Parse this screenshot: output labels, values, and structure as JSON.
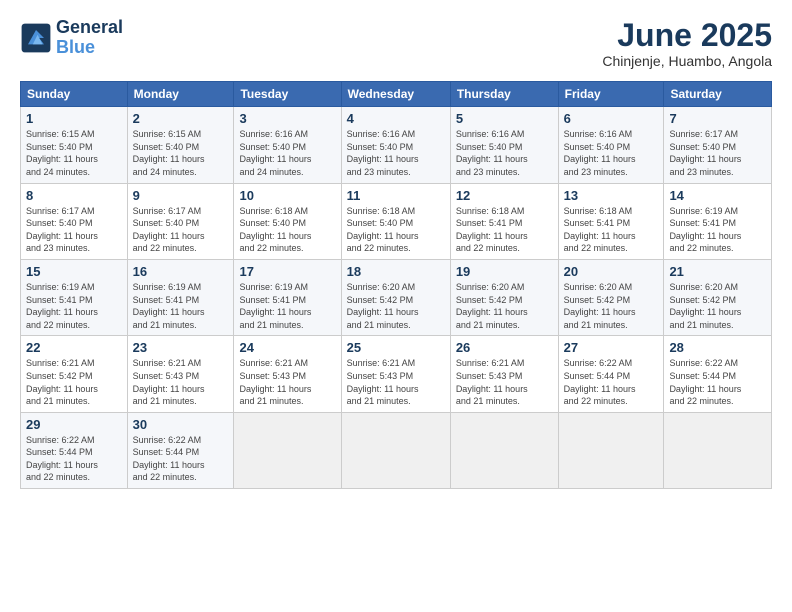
{
  "logo": {
    "line1": "General",
    "line2": "Blue"
  },
  "title": "June 2025",
  "subtitle": "Chinjenje, Huambo, Angola",
  "days_of_week": [
    "Sunday",
    "Monday",
    "Tuesday",
    "Wednesday",
    "Thursday",
    "Friday",
    "Saturday"
  ],
  "weeks": [
    [
      {
        "day": "1",
        "info": "Sunrise: 6:15 AM\nSunset: 5:40 PM\nDaylight: 11 hours\nand 24 minutes."
      },
      {
        "day": "2",
        "info": "Sunrise: 6:15 AM\nSunset: 5:40 PM\nDaylight: 11 hours\nand 24 minutes."
      },
      {
        "day": "3",
        "info": "Sunrise: 6:16 AM\nSunset: 5:40 PM\nDaylight: 11 hours\nand 24 minutes."
      },
      {
        "day": "4",
        "info": "Sunrise: 6:16 AM\nSunset: 5:40 PM\nDaylight: 11 hours\nand 23 minutes."
      },
      {
        "day": "5",
        "info": "Sunrise: 6:16 AM\nSunset: 5:40 PM\nDaylight: 11 hours\nand 23 minutes."
      },
      {
        "day": "6",
        "info": "Sunrise: 6:16 AM\nSunset: 5:40 PM\nDaylight: 11 hours\nand 23 minutes."
      },
      {
        "day": "7",
        "info": "Sunrise: 6:17 AM\nSunset: 5:40 PM\nDaylight: 11 hours\nand 23 minutes."
      }
    ],
    [
      {
        "day": "8",
        "info": "Sunrise: 6:17 AM\nSunset: 5:40 PM\nDaylight: 11 hours\nand 23 minutes."
      },
      {
        "day": "9",
        "info": "Sunrise: 6:17 AM\nSunset: 5:40 PM\nDaylight: 11 hours\nand 22 minutes."
      },
      {
        "day": "10",
        "info": "Sunrise: 6:18 AM\nSunset: 5:40 PM\nDaylight: 11 hours\nand 22 minutes."
      },
      {
        "day": "11",
        "info": "Sunrise: 6:18 AM\nSunset: 5:40 PM\nDaylight: 11 hours\nand 22 minutes."
      },
      {
        "day": "12",
        "info": "Sunrise: 6:18 AM\nSunset: 5:41 PM\nDaylight: 11 hours\nand 22 minutes."
      },
      {
        "day": "13",
        "info": "Sunrise: 6:18 AM\nSunset: 5:41 PM\nDaylight: 11 hours\nand 22 minutes."
      },
      {
        "day": "14",
        "info": "Sunrise: 6:19 AM\nSunset: 5:41 PM\nDaylight: 11 hours\nand 22 minutes."
      }
    ],
    [
      {
        "day": "15",
        "info": "Sunrise: 6:19 AM\nSunset: 5:41 PM\nDaylight: 11 hours\nand 22 minutes."
      },
      {
        "day": "16",
        "info": "Sunrise: 6:19 AM\nSunset: 5:41 PM\nDaylight: 11 hours\nand 21 minutes."
      },
      {
        "day": "17",
        "info": "Sunrise: 6:19 AM\nSunset: 5:41 PM\nDaylight: 11 hours\nand 21 minutes."
      },
      {
        "day": "18",
        "info": "Sunrise: 6:20 AM\nSunset: 5:42 PM\nDaylight: 11 hours\nand 21 minutes."
      },
      {
        "day": "19",
        "info": "Sunrise: 6:20 AM\nSunset: 5:42 PM\nDaylight: 11 hours\nand 21 minutes."
      },
      {
        "day": "20",
        "info": "Sunrise: 6:20 AM\nSunset: 5:42 PM\nDaylight: 11 hours\nand 21 minutes."
      },
      {
        "day": "21",
        "info": "Sunrise: 6:20 AM\nSunset: 5:42 PM\nDaylight: 11 hours\nand 21 minutes."
      }
    ],
    [
      {
        "day": "22",
        "info": "Sunrise: 6:21 AM\nSunset: 5:42 PM\nDaylight: 11 hours\nand 21 minutes."
      },
      {
        "day": "23",
        "info": "Sunrise: 6:21 AM\nSunset: 5:43 PM\nDaylight: 11 hours\nand 21 minutes."
      },
      {
        "day": "24",
        "info": "Sunrise: 6:21 AM\nSunset: 5:43 PM\nDaylight: 11 hours\nand 21 minutes."
      },
      {
        "day": "25",
        "info": "Sunrise: 6:21 AM\nSunset: 5:43 PM\nDaylight: 11 hours\nand 21 minutes."
      },
      {
        "day": "26",
        "info": "Sunrise: 6:21 AM\nSunset: 5:43 PM\nDaylight: 11 hours\nand 21 minutes."
      },
      {
        "day": "27",
        "info": "Sunrise: 6:22 AM\nSunset: 5:44 PM\nDaylight: 11 hours\nand 22 minutes."
      },
      {
        "day": "28",
        "info": "Sunrise: 6:22 AM\nSunset: 5:44 PM\nDaylight: 11 hours\nand 22 minutes."
      }
    ],
    [
      {
        "day": "29",
        "info": "Sunrise: 6:22 AM\nSunset: 5:44 PM\nDaylight: 11 hours\nand 22 minutes."
      },
      {
        "day": "30",
        "info": "Sunrise: 6:22 AM\nSunset: 5:44 PM\nDaylight: 11 hours\nand 22 minutes."
      },
      {
        "day": "",
        "info": ""
      },
      {
        "day": "",
        "info": ""
      },
      {
        "day": "",
        "info": ""
      },
      {
        "day": "",
        "info": ""
      },
      {
        "day": "",
        "info": ""
      }
    ]
  ]
}
